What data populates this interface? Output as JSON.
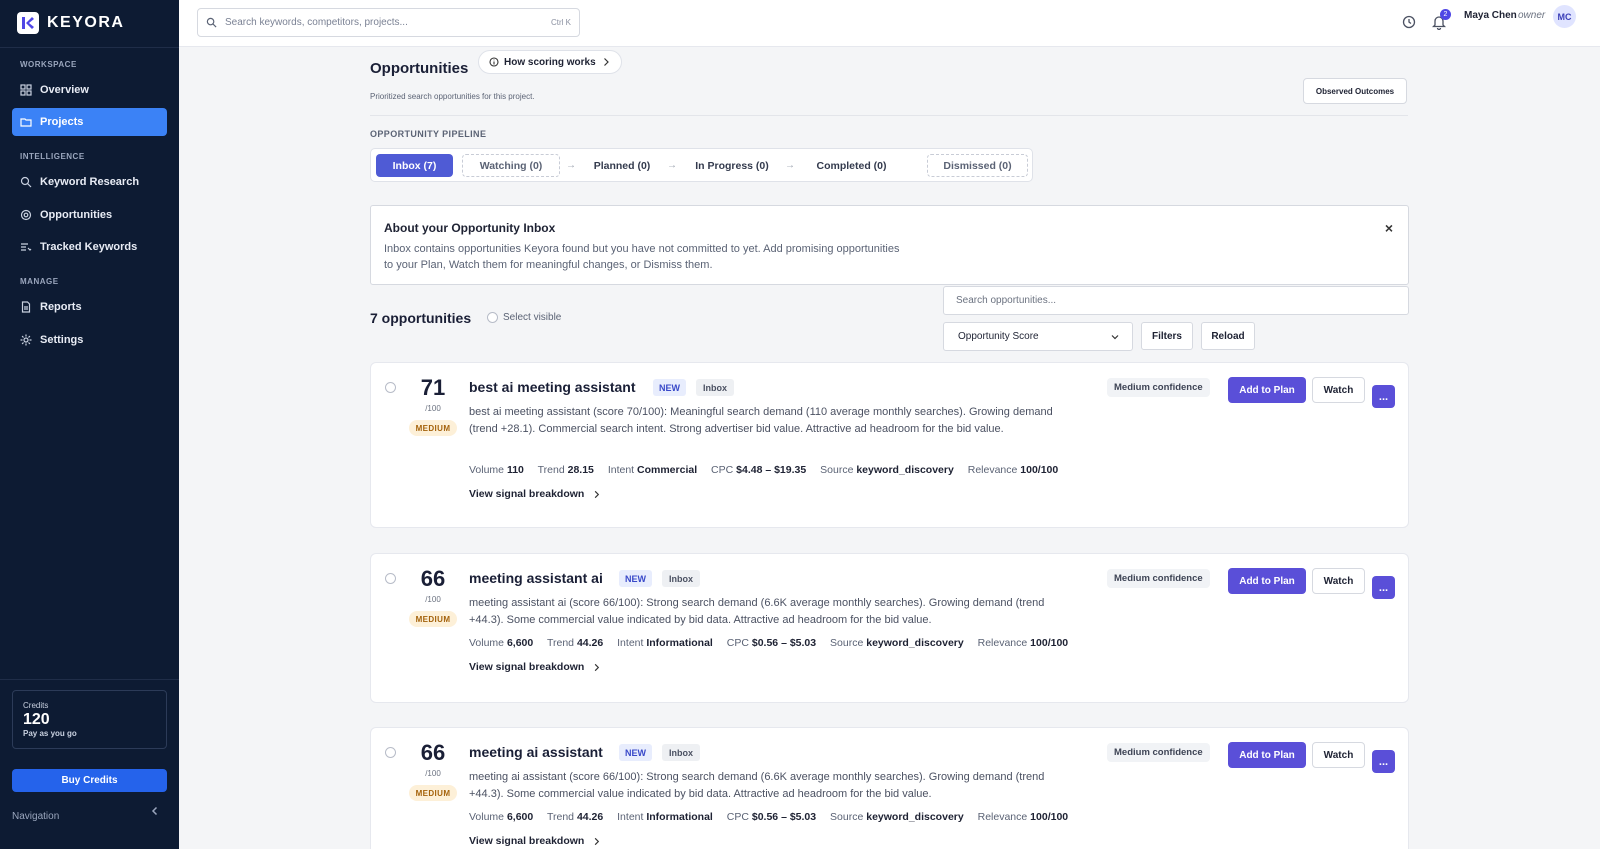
{
  "brand": {
    "name": "KEYORA"
  },
  "topbar": {
    "search_placeholder": "Search keywords, competitors, projects...",
    "shortcut": "Ctrl K",
    "notification_count": "2",
    "user_name": "Maya Chen",
    "user_role": "owner",
    "avatar_initials": "MC"
  },
  "sidebar": {
    "sections": [
      "WORKSPACE",
      "INTELLIGENCE",
      "MANAGE"
    ],
    "items": [
      {
        "label": "Overview",
        "icon": "grid-icon",
        "active": false
      },
      {
        "label": "Projects",
        "icon": "folder-icon",
        "active": true
      },
      {
        "label": "Keyword Research",
        "icon": "search-icon",
        "active": false
      },
      {
        "label": "Opportunities",
        "icon": "target-icon",
        "active": false
      },
      {
        "label": "Tracked Keywords",
        "icon": "list-icon",
        "active": false
      },
      {
        "label": "Reports",
        "icon": "document-icon",
        "active": false
      },
      {
        "label": "Settings",
        "icon": "gear-icon",
        "active": false
      }
    ],
    "credits": {
      "label": "Credits",
      "value": "120",
      "plan": "Pay as you go"
    },
    "buy_credits": "Buy Credits",
    "footer": "Navigation"
  },
  "page": {
    "title": "Opportunities",
    "scoring_link": "How scoring works",
    "subtitle": "Prioritized search opportunities for this project.",
    "observed_outcomes": "Observed Outcomes"
  },
  "pipeline": {
    "label": "OPPORTUNITY PIPELINE",
    "stages": [
      {
        "label": "Inbox (7)",
        "state": "active"
      },
      {
        "label": "Watching (0)",
        "state": "dashed"
      },
      {
        "label": "Planned (0)",
        "state": "normal"
      },
      {
        "label": "In Progress (0)",
        "state": "normal"
      },
      {
        "label": "Completed (0)",
        "state": "normal"
      },
      {
        "label": "Dismissed (0)",
        "state": "dashed"
      }
    ]
  },
  "info": {
    "title": "About your Opportunity Inbox",
    "text": "Inbox contains opportunities Keyora found but you have not committed to yet. Add promising opportunities to your Plan, Watch them for meaningful changes, or Dismiss them.",
    "close": "×"
  },
  "list": {
    "count_label": "7 opportunities",
    "select_visible": "Select visible",
    "search_placeholder": "Search opportunities...",
    "sort_value": "Opportunity Score",
    "filters": "Filters",
    "reload": "Reload"
  },
  "labels": {
    "volume": "Volume",
    "trend": "Trend",
    "intent": "Intent",
    "cpc": "CPC",
    "source": "Source",
    "relevance": "Relevance",
    "view_breakdown": "View signal breakdown",
    "add_to_plan": "Add to Plan",
    "watch": "Watch",
    "more": "..."
  },
  "opportunities": [
    {
      "score": "71",
      "score_max": "/100",
      "band": "MEDIUM",
      "title": "best ai meeting assistant",
      "badge_new": "NEW",
      "badge_status": "Inbox",
      "description": "best ai meeting assistant (score 70/100): Meaningful search demand (110 average monthly searches). Growing demand (trend +28.1). Commercial search intent. Strong advertiser bid value. Attractive ad headroom for the bid value.",
      "volume": "110",
      "trend": "28.15",
      "intent": "Commercial",
      "cpc": "$4.48 – $19.35",
      "source": "keyword_discovery",
      "relevance": "100/100",
      "confidence": "Medium confidence"
    },
    {
      "score": "66",
      "score_max": "/100",
      "band": "MEDIUM",
      "title": "meeting assistant ai",
      "badge_new": "NEW",
      "badge_status": "Inbox",
      "description": "meeting assistant ai (score 66/100): Strong search demand (6.6K average monthly searches). Growing demand (trend +44.3). Some commercial value indicated by bid data. Attractive ad headroom for the bid value.",
      "volume": "6,600",
      "trend": "44.26",
      "intent": "Informational",
      "cpc": "$0.56 – $5.03",
      "source": "keyword_discovery",
      "relevance": "100/100",
      "confidence": "Medium confidence"
    },
    {
      "score": "66",
      "score_max": "/100",
      "band": "MEDIUM",
      "title": "meeting ai assistant",
      "badge_new": "NEW",
      "badge_status": "Inbox",
      "description": "meeting ai assistant (score 66/100): Strong search demand (6.6K average monthly searches). Growing demand (trend +44.3). Some commercial value indicated by bid data. Attractive ad headroom for the bid value.",
      "volume": "6,600",
      "trend": "44.26",
      "intent": "Informational",
      "cpc": "$0.56 – $5.03",
      "source": "keyword_discovery",
      "relevance": "100/100",
      "confidence": "Medium confidence"
    }
  ]
}
